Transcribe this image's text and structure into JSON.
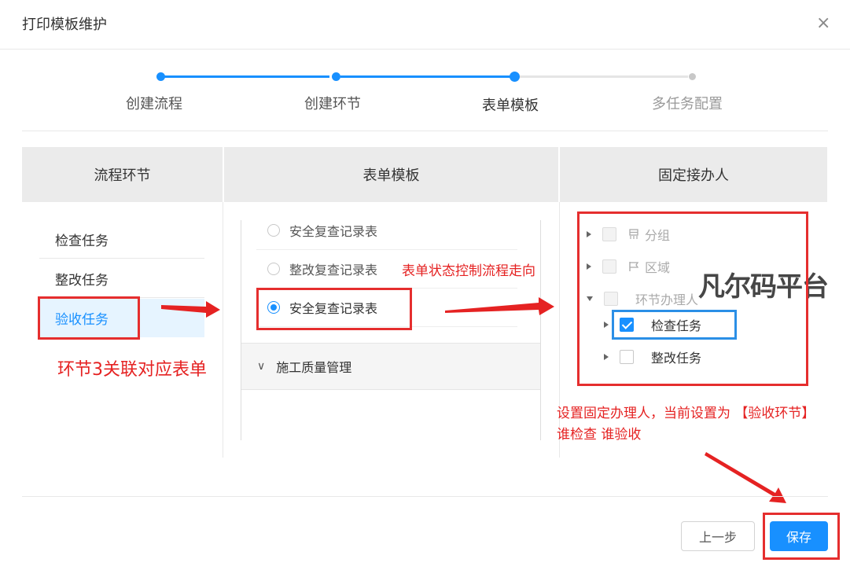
{
  "dialog": {
    "title": "打印模板维护",
    "close_glyph": "×"
  },
  "steps": [
    {
      "label": "创建流程",
      "state": "done"
    },
    {
      "label": "创建环节",
      "state": "done"
    },
    {
      "label": "表单模板",
      "state": "current"
    },
    {
      "label": "多任务配置",
      "state": "pending"
    }
  ],
  "colors": {
    "primary": "#1890ff",
    "annotation_red": "#e52e2e",
    "annotation_blue": "#2b8fe6"
  },
  "columns": {
    "process_nodes": "流程环节",
    "form_templates": "表单模板",
    "fixed_handler": "固定接办人"
  },
  "process_nodes": [
    {
      "label": "检查任务",
      "active": false
    },
    {
      "label": "整改任务",
      "active": false
    },
    {
      "label": "验收任务",
      "active": true
    }
  ],
  "form_templates": {
    "options": [
      {
        "label": "安全复查记录表",
        "selected": false
      },
      {
        "label": "整改复查记录表",
        "selected": false
      },
      {
        "label": "安全复查记录表",
        "selected": true
      }
    ],
    "group": {
      "label": "施工质量管理",
      "chevron_glyph": "∨"
    }
  },
  "handler_tree": [
    {
      "label": "分组",
      "icon": "group-icon",
      "disabled": true
    },
    {
      "label": "区域",
      "icon": "flag-icon",
      "disabled": true
    },
    {
      "label": "环节办理人",
      "disabled": true,
      "expanded": true,
      "children": [
        {
          "label": "检查任务",
          "checked": true
        },
        {
          "label": "整改任务",
          "checked": false
        }
      ]
    }
  ],
  "annotations": {
    "node_link": "环节3关联对应表单",
    "form_state": "表单状态控制流程走向",
    "handler_line1": "设置固定办理人，当前设置为 【验收环节】",
    "handler_line2": "谁检查 谁验收"
  },
  "watermark": "凡尔码平台",
  "footer": {
    "prev_label": "上一步",
    "save_label": "保存"
  }
}
